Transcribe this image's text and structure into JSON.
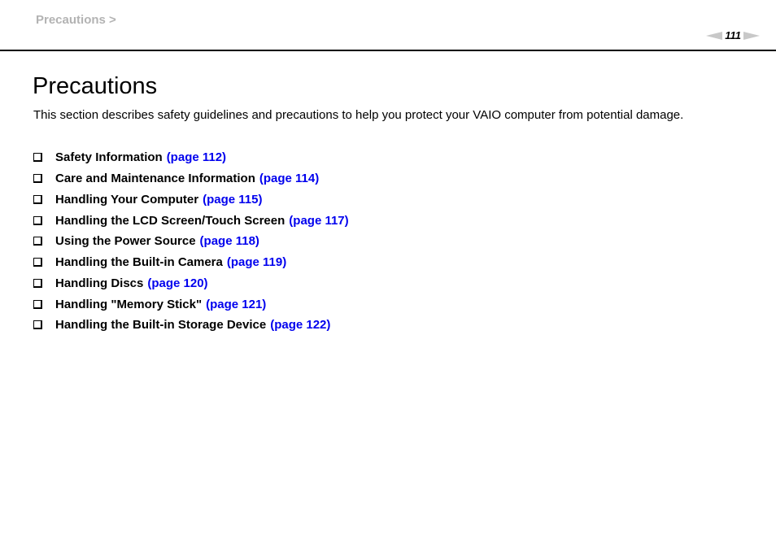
{
  "header": {
    "breadcrumb": "Precautions >",
    "page_number": "111",
    "prev_icon": "arrow-left-icon",
    "next_icon": "arrow-right-icon"
  },
  "main": {
    "title": "Precautions",
    "intro": "This section describes safety guidelines and precautions to help you protect your VAIO computer from potential damage.",
    "bullet_icon": "checkbox-bullet-icon",
    "link_color": "#0000ee",
    "topics": [
      {
        "label": "Safety Information",
        "link": "(page 112)"
      },
      {
        "label": "Care and Maintenance Information",
        "link": "(page 114)"
      },
      {
        "label": "Handling Your Computer",
        "link": "(page 115)"
      },
      {
        "label": "Handling the LCD Screen/Touch Screen",
        "link": "(page 117)"
      },
      {
        "label": "Using the Power Source",
        "link": "(page 118)"
      },
      {
        "label": "Handling the Built-in Camera",
        "link": "(page 119)"
      },
      {
        "label": "Handling Discs",
        "link": "(page 120)"
      },
      {
        "label": "Handling \"Memory Stick\"",
        "link": "(page 121)"
      },
      {
        "label": "Handling the Built-in Storage Device",
        "link": "(page 122)"
      }
    ]
  }
}
